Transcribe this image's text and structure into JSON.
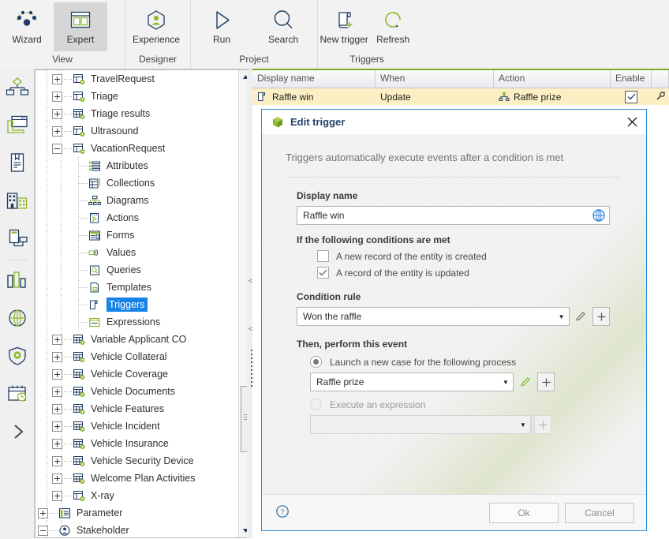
{
  "ribbon": {
    "groups": [
      {
        "name": "View",
        "items": [
          {
            "label": "Wizard",
            "icon": "wizard-icon",
            "selected": false
          },
          {
            "label": "Expert",
            "icon": "expert-icon",
            "selected": true
          }
        ]
      },
      {
        "name": "Designer",
        "items": [
          {
            "label": "Experience",
            "icon": "experience-icon",
            "selected": false
          }
        ]
      },
      {
        "name": "Project",
        "items": [
          {
            "label": "Run",
            "icon": "run-icon",
            "selected": false
          },
          {
            "label": "Search",
            "icon": "search-icon",
            "selected": false
          }
        ]
      },
      {
        "name": "Triggers",
        "items": [
          {
            "label": "New trigger",
            "icon": "new-trigger-icon",
            "selected": false
          },
          {
            "label": "Refresh",
            "icon": "refresh-icon",
            "selected": false
          }
        ]
      }
    ]
  },
  "rail": {
    "items": [
      {
        "name": "organization-icon"
      },
      {
        "name": "window-application-icon"
      },
      {
        "name": "document-icon"
      },
      {
        "name": "buildings-icon"
      },
      {
        "name": "devices-icon"
      },
      {
        "name": "charts-icon"
      },
      {
        "name": "globe-icon"
      },
      {
        "name": "shield-settings-icon"
      },
      {
        "name": "calendar-clock-icon"
      },
      {
        "name": "expand-chevron-icon"
      }
    ]
  },
  "tree": {
    "nodes": [
      {
        "label": "TravelRequest",
        "level": 1,
        "toggle": "plus",
        "icon": "entity-icon",
        "selected": false
      },
      {
        "label": "Triage",
        "level": 1,
        "toggle": "plus",
        "icon": "entity-icon",
        "selected": false
      },
      {
        "label": "Triage results",
        "level": 1,
        "toggle": "plus",
        "icon": "entity-group-icon",
        "selected": false
      },
      {
        "label": "Ultrasound",
        "level": 1,
        "toggle": "plus",
        "icon": "entity-icon",
        "selected": false
      },
      {
        "label": "VacationRequest",
        "level": 1,
        "toggle": "minus",
        "icon": "entity-icon",
        "selected": false
      },
      {
        "label": "Attributes",
        "level": 2,
        "toggle": "none",
        "icon": "attributes-icon",
        "selected": false
      },
      {
        "label": "Collections",
        "level": 2,
        "toggle": "none",
        "icon": "collections-icon",
        "selected": false
      },
      {
        "label": "Diagrams",
        "level": 2,
        "toggle": "none",
        "icon": "diagrams-icon",
        "selected": false
      },
      {
        "label": "Actions",
        "level": 2,
        "toggle": "none",
        "icon": "actions-icon",
        "selected": false
      },
      {
        "label": "Forms",
        "level": 2,
        "toggle": "none",
        "icon": "forms-icon",
        "selected": false
      },
      {
        "label": "Values",
        "level": 2,
        "toggle": "none",
        "icon": "values-icon",
        "selected": false
      },
      {
        "label": "Queries",
        "level": 2,
        "toggle": "none",
        "icon": "queries-icon",
        "selected": false
      },
      {
        "label": "Templates",
        "level": 2,
        "toggle": "none",
        "icon": "templates-icon",
        "selected": false
      },
      {
        "label": "Triggers",
        "level": 2,
        "toggle": "none",
        "icon": "triggers-icon",
        "selected": true
      },
      {
        "label": "Expressions",
        "level": 2,
        "toggle": "none",
        "icon": "expressions-icon",
        "selected": false
      },
      {
        "label": "Variable Applicant CO",
        "level": 1,
        "toggle": "plus",
        "icon": "entity-group-icon",
        "selected": false
      },
      {
        "label": "Vehicle Collateral",
        "level": 1,
        "toggle": "plus",
        "icon": "entity-group-icon",
        "selected": false
      },
      {
        "label": "Vehicle Coverage",
        "level": 1,
        "toggle": "plus",
        "icon": "entity-group-icon",
        "selected": false
      },
      {
        "label": "Vehicle Documents",
        "level": 1,
        "toggle": "plus",
        "icon": "entity-group-icon",
        "selected": false
      },
      {
        "label": "Vehicle Features",
        "level": 1,
        "toggle": "plus",
        "icon": "entity-group-icon",
        "selected": false
      },
      {
        "label": "Vehicle Incident",
        "level": 1,
        "toggle": "plus",
        "icon": "entity-group-icon",
        "selected": false
      },
      {
        "label": "Vehicle Insurance",
        "level": 1,
        "toggle": "plus",
        "icon": "entity-group-icon",
        "selected": false
      },
      {
        "label": "Vehicle Security Device",
        "level": 1,
        "toggle": "plus",
        "icon": "entity-group-icon",
        "selected": false
      },
      {
        "label": "Welcome Plan Activities",
        "level": 1,
        "toggle": "plus",
        "icon": "entity-group-icon",
        "selected": false
      },
      {
        "label": "X-ray",
        "level": 1,
        "toggle": "plus",
        "icon": "entity-icon",
        "selected": false
      },
      {
        "label": "Parameter",
        "level": 0,
        "toggle": "plus",
        "icon": "parameter-icon",
        "selected": false
      },
      {
        "label": "Stakeholder",
        "level": 0,
        "toggle": "minus",
        "icon": "stakeholder-icon",
        "selected": false
      }
    ]
  },
  "table": {
    "columns": [
      "Display name",
      "When",
      "Action",
      "Enable",
      ""
    ],
    "rows": [
      {
        "display_name": "Raffle win",
        "when": "Update",
        "action": "Raffle prize",
        "enable": true
      }
    ]
  },
  "dialog": {
    "title": "Edit trigger",
    "icon": "cube-icon",
    "close_icon": "close-icon",
    "intro": "Triggers automatically execute events after a condition is met",
    "display_name_label": "Display name",
    "display_name_value": "Raffle win",
    "display_name_button_icon": "globe-translate-icon",
    "conditions_label": "If the following conditions are met",
    "conditions": [
      {
        "label": "A new record of the entity is created",
        "checked": false
      },
      {
        "label": "A record of the entity is updated",
        "checked": true
      }
    ],
    "condition_rule_label": "Condition rule",
    "condition_rule_value": "Won the raffle",
    "condition_rule_edit_icon": "pencil-icon",
    "condition_rule_add_icon": "plus-icon",
    "event_label": "Then, perform this event",
    "options": [
      {
        "label": "Launch a new case for the following process",
        "selected": true,
        "value": "Raffle prize",
        "edit_icon": "pencil-icon",
        "add_icon": "plus-icon",
        "enabled": true
      },
      {
        "label": "Execute an expression",
        "selected": false,
        "value": "",
        "edit_icon": "",
        "add_icon": "plus-icon",
        "enabled": false
      }
    ],
    "help_icon": "help-icon",
    "ok_label": "Ok",
    "cancel_label": "Cancel"
  },
  "colors": {
    "accent_green": "#7ca92b",
    "dialog_border": "#2e8bd6",
    "selection_blue": "#1683e8",
    "row_highlight": "#fcefc4",
    "navy": "#1f3d63"
  }
}
